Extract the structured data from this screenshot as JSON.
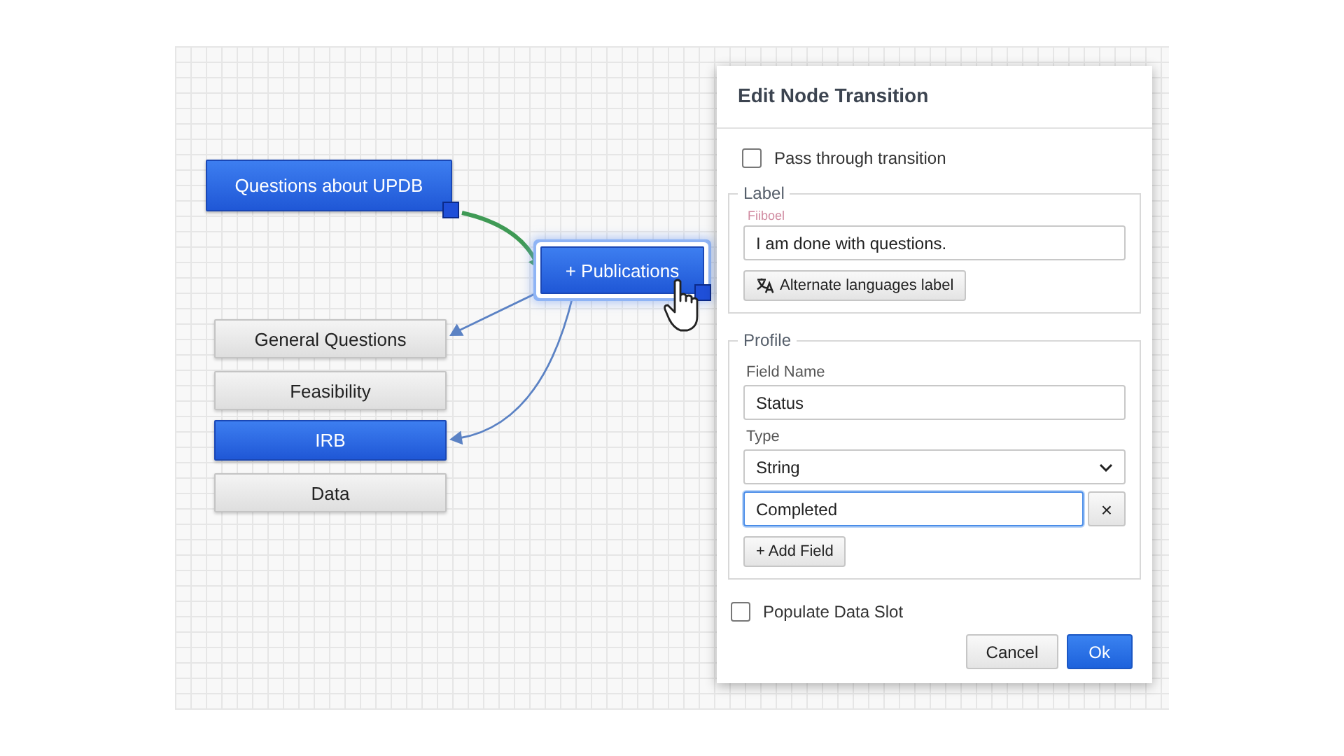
{
  "canvas": {
    "nodes": [
      {
        "label": "Questions about UPDB",
        "kind": "primary",
        "selected": false,
        "handle": true
      },
      {
        "label": "+ Publications",
        "kind": "primary",
        "selected": true,
        "handle": true
      },
      {
        "label": "General Questions",
        "kind": "plain",
        "selected": false,
        "handle": false
      },
      {
        "label": "Feasibility",
        "kind": "plain",
        "selected": false,
        "handle": false
      },
      {
        "label": "IRB",
        "kind": "primary",
        "selected": false,
        "handle": false
      },
      {
        "label": "Data",
        "kind": "plain",
        "selected": false,
        "handle": false
      }
    ],
    "connectors": [
      {
        "kind": "active"
      },
      {
        "kind": "normal"
      },
      {
        "kind": "normal"
      }
    ]
  },
  "dialog": {
    "title": "Edit Node Transition",
    "pass_through": {
      "label": "Pass through transition",
      "checked": false
    },
    "label_section": {
      "legend": "Label",
      "field_label": "Fiiboel",
      "value": "I am done with questions.",
      "alt_button": "Alternate languages label"
    },
    "profile": {
      "legend": "Profile",
      "field_name_label": "Field Name",
      "field_name": "Status",
      "type_label": "Type",
      "type": "String",
      "values": [
        {
          "value": "Completed",
          "focused": true,
          "remove": "×"
        }
      ],
      "add_button": "+ Add Field"
    },
    "populate": {
      "label": "Populate Data Slot",
      "checked": false
    },
    "buttons": [
      {
        "label": "Cancel",
        "kind": "secondary"
      },
      {
        "label": "Ok",
        "kind": "primary"
      }
    ]
  }
}
